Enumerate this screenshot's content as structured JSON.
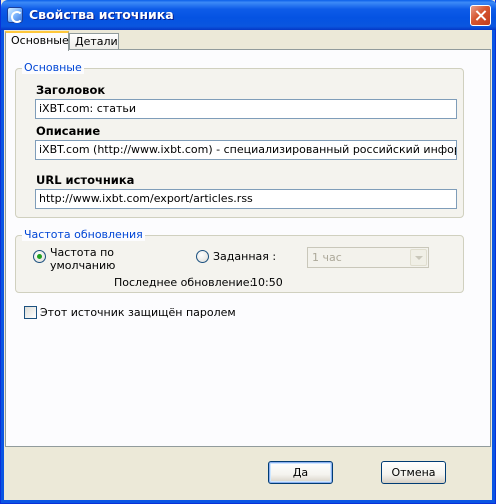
{
  "window": {
    "title": "Свойства источника"
  },
  "tabs": [
    {
      "label": "Основные",
      "active": true
    },
    {
      "label": "Детали",
      "active": false
    }
  ],
  "main_group": {
    "legend": "Основные",
    "title_label": "Заголовок",
    "title_value": "iXBT.com: статьи",
    "description_label": "Описание",
    "description_value": "iXBT.com (http://www.ixbt.com) - специализированный российский информационн",
    "url_label": "URL источника",
    "url_value": "http://www.ixbt.com/export/articles.rss"
  },
  "update_group": {
    "legend": "Частота обновления",
    "default_radio_label_line1": "Частота по",
    "default_radio_label_line2": "умолчанию",
    "default_radio_checked": true,
    "custom_radio_label": "Заданная :",
    "custom_radio_checked": false,
    "interval_select_value": "1 час",
    "last_update_label": "Последнее обновление:",
    "last_update_value": "10:50"
  },
  "password_checkbox": {
    "label": "Этот источник защищён паролем",
    "checked": false
  },
  "buttons": {
    "ok": "Да",
    "cancel": "Отмена"
  },
  "colors": {
    "accent": "#0046D5",
    "titlebar": "#0553E2",
    "radio_dot": "#21A121"
  }
}
